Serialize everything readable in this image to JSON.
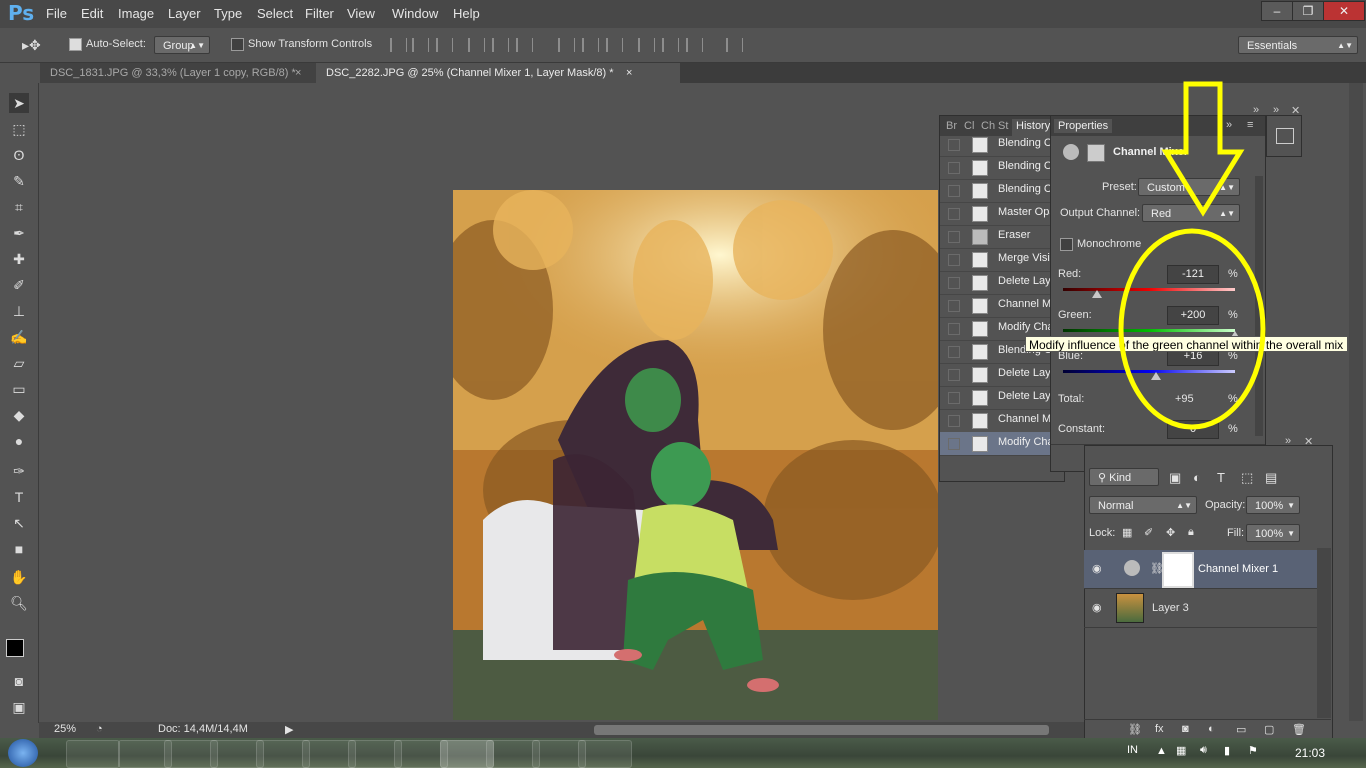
{
  "app": {
    "logo": "Ps"
  },
  "menu": [
    "File",
    "Edit",
    "Image",
    "Layer",
    "Type",
    "Select",
    "Filter",
    "View",
    "Window",
    "Help"
  ],
  "window_controls": [
    "–",
    "❐",
    "✕"
  ],
  "options": {
    "auto_select_label": "Auto-Select:",
    "auto_select_value": "Group",
    "show_transform_label": "Show Transform Controls",
    "workspace": "Essentials"
  },
  "tabs": [
    {
      "label": "DSC_1831.JPG @ 33,3% (Layer 1 copy, RGB/8) *",
      "close": "×"
    },
    {
      "label": "DSC_2282.JPG @ 25% (Channel Mixer 1, Layer Mask/8) *",
      "close": "×"
    }
  ],
  "history_panel": {
    "tabs": [
      "Br",
      "Cl",
      "Ch",
      "St",
      "History"
    ],
    "items": [
      "Blending Cl",
      "Blending Cl",
      "Blending Cl",
      "Master Opa",
      "Eraser",
      "Merge Visib",
      "Delete Laye",
      "Channel Mi",
      "Modify Cha",
      "Blending C",
      "Delete Laye",
      "Delete Laye",
      "Channel Mi",
      "Modify Cha"
    ]
  },
  "properties": {
    "tab": "Properties",
    "title": "Channel Mixer",
    "preset_label": "Preset:",
    "preset_value": "Custom",
    "output_label": "Output Channel:",
    "output_value": "Red",
    "monochrome_label": "Monochrome",
    "red_label": "Red:",
    "red_value": "-121",
    "green_label": "Green:",
    "green_value": "+200",
    "blue_label": "Blue:",
    "blue_value": "+16",
    "total_label": "Total:",
    "total_value": "+95",
    "constant_label": "Constant:",
    "constant_value": "0",
    "percent": "%",
    "sliders": {
      "red": -121,
      "green": 200,
      "blue": 16
    }
  },
  "tooltip": "Modify influence of the green channel within the overall mix",
  "layers": {
    "kind_label": "Kind",
    "blend_mode": "Normal",
    "opacity_label": "Opacity:",
    "opacity_value": "100%",
    "lock_label": "Lock:",
    "fill_label": "Fill:",
    "fill_value": "100%",
    "items": [
      "Channel Mixer 1",
      "Layer 3"
    ]
  },
  "status": {
    "zoom": "25%",
    "doc": "Doc: 14,4M/14,4M"
  },
  "taskbar": {
    "lang": "IN",
    "time": "21:03"
  },
  "colors": {
    "annotation": "#ffff00",
    "accent": "#5fb0ef"
  }
}
